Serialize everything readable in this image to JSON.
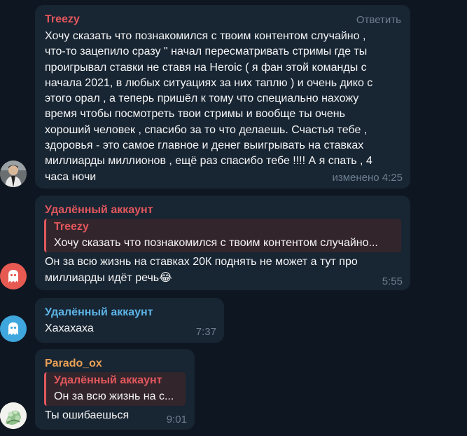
{
  "colors": {
    "background": "#0e1621",
    "bubble": "#182533",
    "text": "#f5f5f5",
    "meta": "#6d7f8f",
    "name_red": "#e2575c",
    "name_blue": "#5cb4e6",
    "name_orange": "#eaa155"
  },
  "messages": [
    {
      "sender": "Treezy",
      "action": "Ответить",
      "text": "Хочу сказать что познакомился с твоим контентом случайно ,\nчто-то зацепило сразу \" начал пересматривать стримы где ты\nпроигрывал ставки не ставя на Heroic ( я фан этой команды с\nначала 2021, в любых ситуациях за них таплю ) и очень дико с\nэтого орал , а теперь пришёл к тому что специально нахожу\nвремя чтобы посмотреть твои стримы и вообще ты очень\nхороший человек , спасибо за то что делаешь. Счастья тебе ,\nздоровья - это самое главное и денег выигрывать на ставках\nмиллиарды миллионов , ещё раз спасибо тебе !!!! А я спать , 4\nчаса ночи",
      "time": "изменено 4:25",
      "avatar_icon": "person-photo-icon"
    },
    {
      "sender": "Удалённый аккаунт",
      "reply": {
        "name": "Treezy",
        "text": "Хочу сказать что познакомился с твоим контентом случайно..."
      },
      "text": "Он за всю жизнь на ставках 20К поднять не может а тут про\nмиллиарды идёт речь",
      "emoji": "😂",
      "time": "5:55",
      "avatar_icon": "ghost-icon"
    },
    {
      "sender": "Удалённый аккаунт",
      "text": "Хахахаха",
      "time": "7:37",
      "avatar_icon": "ghost-icon"
    },
    {
      "sender": "Parado_ox",
      "reply": {
        "name": "Удалённый аккаунт",
        "text": "Он за всю жизнь на с..."
      },
      "text": "Ты ошибаешься",
      "time": "9:01",
      "avatar_icon": "flower-sticker-icon"
    }
  ]
}
